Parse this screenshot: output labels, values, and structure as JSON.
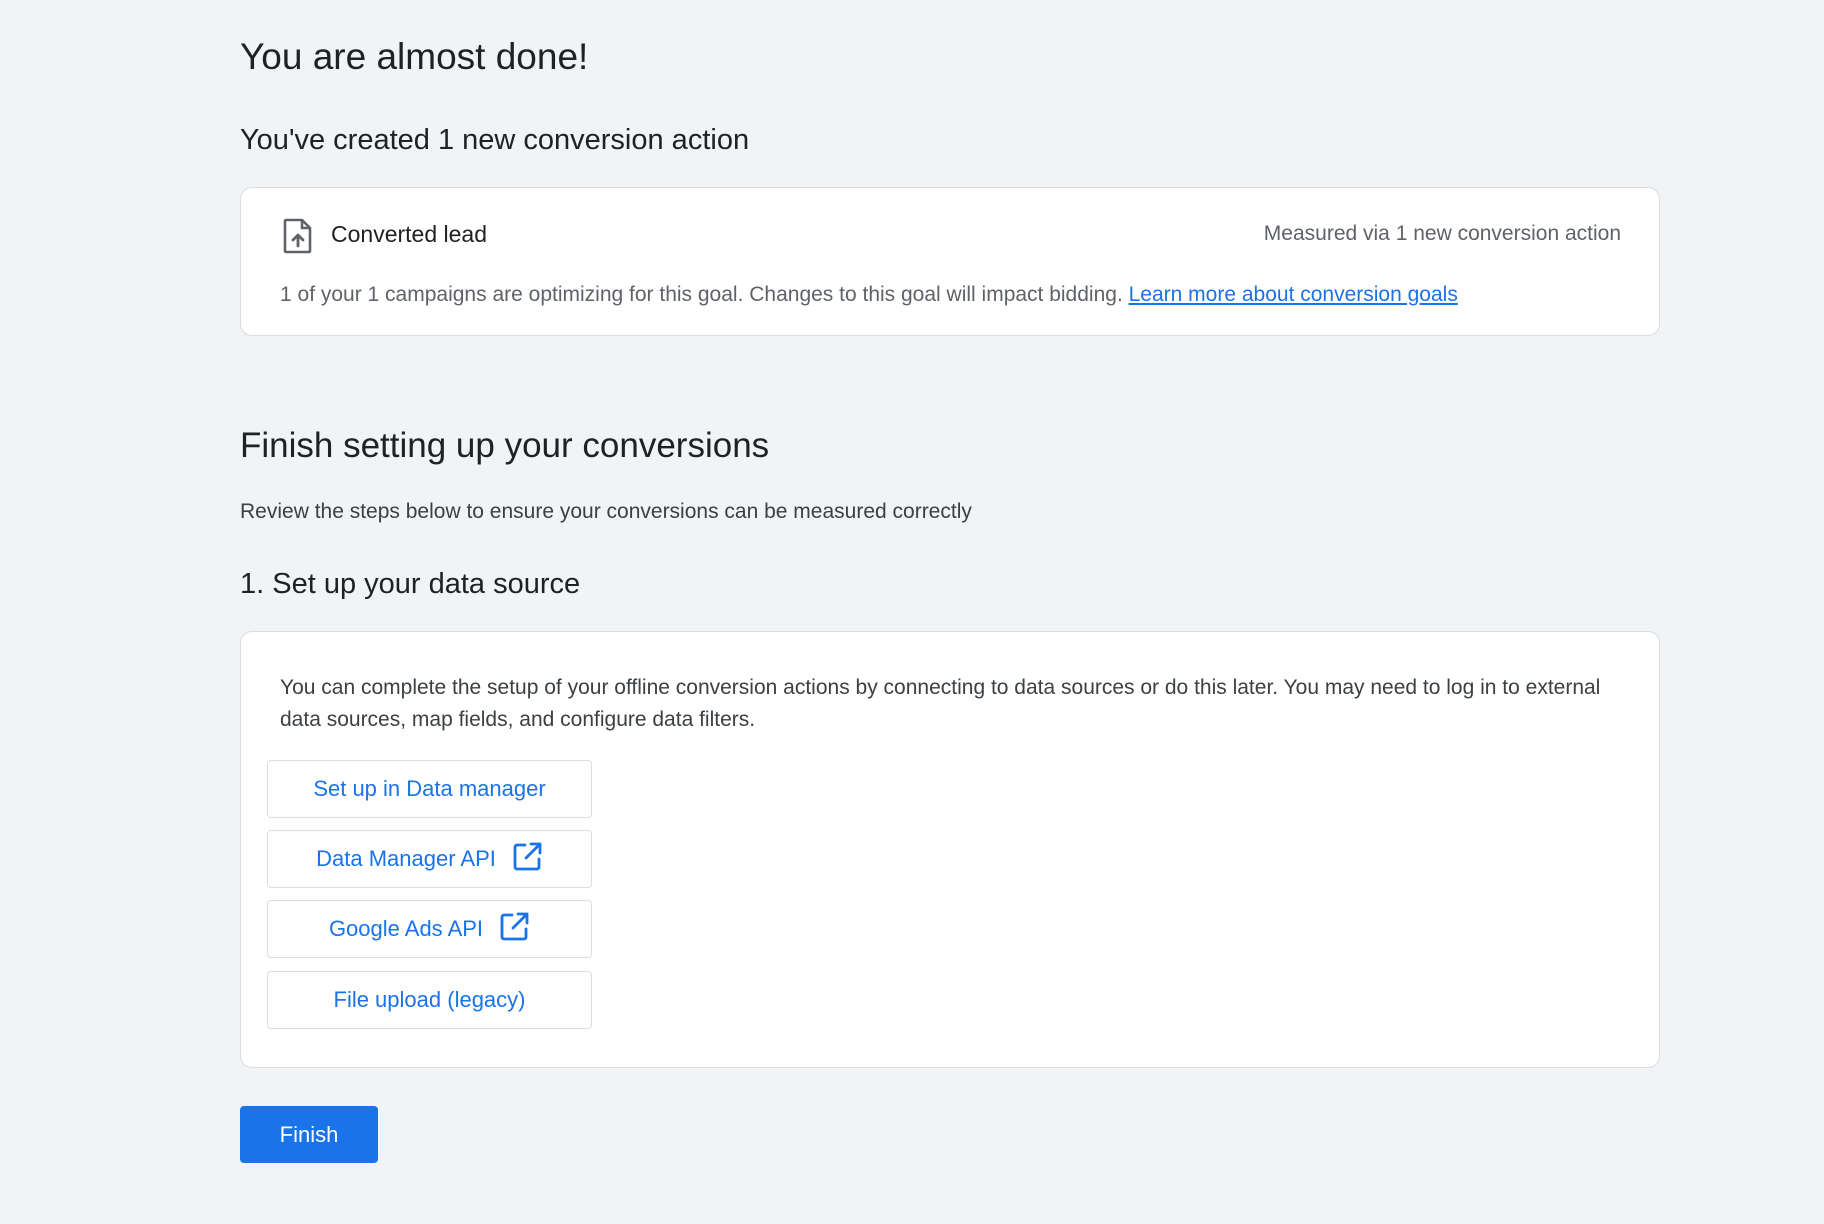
{
  "header": {
    "title": "You are almost done!",
    "created_summary": "You've created 1 new conversion action"
  },
  "goal_card": {
    "icon": "file-upload-icon",
    "name": "Converted lead",
    "measured": "Measured via 1 new conversion action",
    "description": "1 of your 1 campaigns are optimizing for this goal. Changes to this goal will impact bidding.",
    "link_text": "Learn more about conversion goals"
  },
  "finish_setup": {
    "title": "Finish setting up your conversions",
    "subtitle": "Review the steps below to ensure your conversions can be measured correctly"
  },
  "step1": {
    "title": "1. Set up your data source",
    "description": "You can complete the setup of your offline conversion actions by connecting to data sources or do this later. You may need to log in to external data sources, map fields, and configure data filters.",
    "buttons": [
      {
        "label": "Set up in Data manager",
        "icon": null
      },
      {
        "label": "Data Manager API",
        "icon": "open-in-new-icon"
      },
      {
        "label": "Google Ads API",
        "icon": "open-in-new-icon"
      },
      {
        "label": "File upload (legacy)",
        "icon": null
      }
    ]
  },
  "footer": {
    "finish_label": "Finish"
  },
  "colors": {
    "background": "#f1f3f4",
    "primary": "#1a73e8",
    "card_border": "#dadce0",
    "secondary_text": "#5f6368"
  }
}
